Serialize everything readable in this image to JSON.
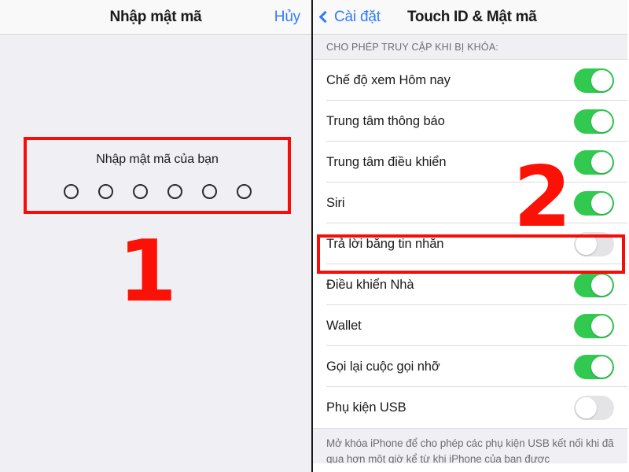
{
  "left_panel": {
    "header": {
      "title": "Nhập mật mã",
      "cancel_label": "Hủy"
    },
    "passcode": {
      "prompt": "Nhập mật mã của bạn",
      "dot_count": 6,
      "filled_count": 0
    },
    "annotation": {
      "number": "1"
    }
  },
  "right_panel": {
    "header": {
      "back_label": "Cài đặt",
      "title": "Touch ID & Mật mã",
      "back_icon": "chevron-left-icon"
    },
    "section": {
      "header": "CHO PHÉP TRUY CẬP KHI BỊ KHÓA:"
    },
    "rows": [
      {
        "label": "Chế độ xem Hôm nay",
        "state": "on"
      },
      {
        "label": "Trung tâm thông báo",
        "state": "on"
      },
      {
        "label": "Trung tâm điều khiển",
        "state": "on"
      },
      {
        "label": "Siri",
        "state": "on"
      },
      {
        "label": "Trả lời bằng tin nhắn",
        "state": "off"
      },
      {
        "label": "Điều khiển Nhà",
        "state": "on"
      },
      {
        "label": "Wallet",
        "state": "on"
      },
      {
        "label": "Gọi lại cuộc gọi nhỡ",
        "state": "on"
      },
      {
        "label": "Phụ kiện USB",
        "state": "off"
      }
    ],
    "footer_note": "Mở khóa iPhone để cho phép các phụ kiện USB kết nối khi đã qua hơn một giờ kể từ khi iPhone của bạn được",
    "annotation": {
      "number": "2"
    }
  },
  "colors": {
    "toggle_on": "#31C950",
    "toggle_off": "#E4E4E6",
    "accent_blue": "#2F7CF6",
    "annotation_red": "#FB1105",
    "highlight_box_red": "#F60C08",
    "panel_bg": "#F0EFF4",
    "section_bg": "#EFEFF4"
  }
}
